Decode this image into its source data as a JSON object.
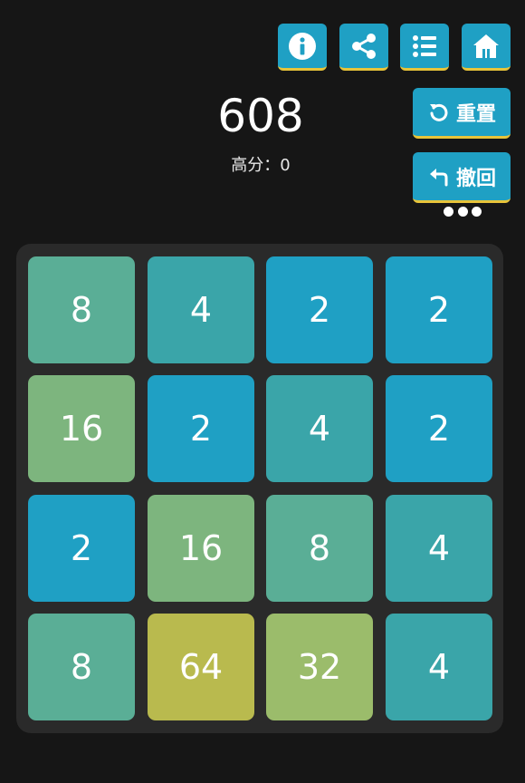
{
  "score": "608",
  "best_score": "高分：0",
  "buttons": {
    "reset_label": "重置",
    "undo_label": "撤回"
  },
  "icons": [
    "info-icon",
    "share-icon",
    "list-icon",
    "home-icon",
    "reset-icon",
    "undo-icon",
    "more-icon"
  ],
  "colors": {
    "background": "#161616",
    "board": "#2a2a2a",
    "button": "#1fa0c4",
    "button_accent": "#e8c43a",
    "tile_2": "#1fa0c4",
    "tile_4": "#3aa5a9",
    "tile_8": "#5aae96",
    "tile_16": "#7db57e",
    "tile_32": "#9bbc6b",
    "tile_64": "#b9ba4e"
  },
  "board": [
    [
      "8",
      "4",
      "2",
      "2"
    ],
    [
      "16",
      "2",
      "4",
      "2"
    ],
    [
      "2",
      "16",
      "8",
      "4"
    ],
    [
      "8",
      "64",
      "32",
      "4"
    ]
  ]
}
